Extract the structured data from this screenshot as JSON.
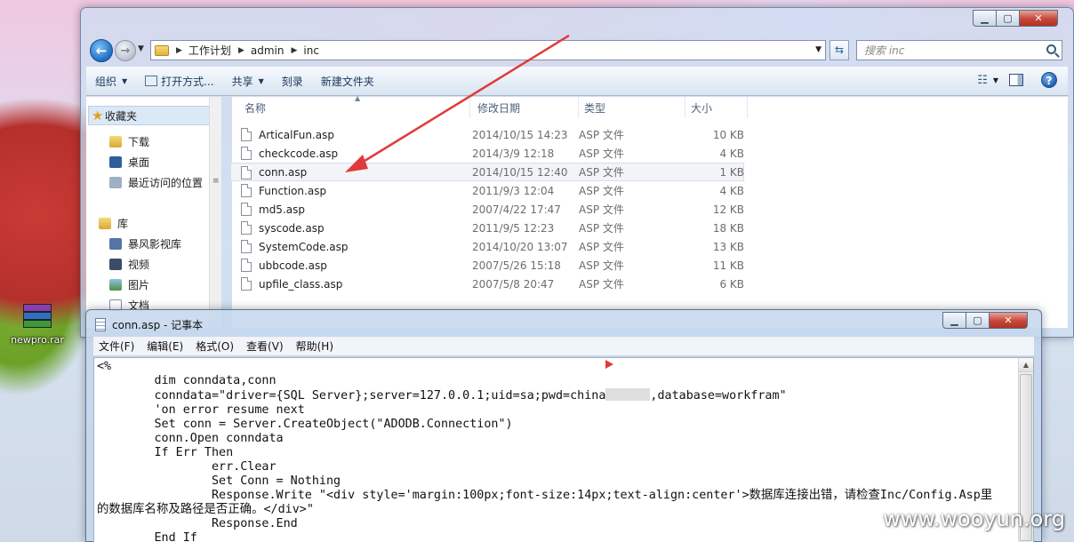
{
  "explorer": {
    "breadcrumb": [
      "工作计划",
      "admin",
      "inc"
    ],
    "search_placeholder": "搜索 inc",
    "toolbar": {
      "organize": "组织",
      "open_with": "打开方式...",
      "share": "共享",
      "burn": "刻录",
      "new_folder": "新建文件夹"
    },
    "nav": {
      "favorites": "收藏夹",
      "downloads": "下载",
      "desktop": "桌面",
      "recent": "最近访问的位置",
      "libraries": "库",
      "storm_video": "暴风影视库",
      "videos": "视频",
      "pictures": "图片",
      "documents": "文档"
    },
    "columns": {
      "name": "名称",
      "modified": "修改日期",
      "type": "类型",
      "size": "大小"
    },
    "files": [
      {
        "name": "ArticalFun.asp",
        "date": "2014/10/15 14:23",
        "type": "ASP 文件",
        "size": "10 KB"
      },
      {
        "name": "checkcode.asp",
        "date": "2014/3/9 12:18",
        "type": "ASP 文件",
        "size": "4 KB"
      },
      {
        "name": "conn.asp",
        "date": "2014/10/15 12:40",
        "type": "ASP 文件",
        "size": "1 KB"
      },
      {
        "name": "Function.asp",
        "date": "2011/9/3 12:04",
        "type": "ASP 文件",
        "size": "4 KB"
      },
      {
        "name": "md5.asp",
        "date": "2007/4/22 17:47",
        "type": "ASP 文件",
        "size": "12 KB"
      },
      {
        "name": "syscode.asp",
        "date": "2011/9/5 12:23",
        "type": "ASP 文件",
        "size": "18 KB"
      },
      {
        "name": "SystemCode.asp",
        "date": "2014/10/20 13:07",
        "type": "ASP 文件",
        "size": "13 KB"
      },
      {
        "name": "ubbcode.asp",
        "date": "2007/5/26 15:18",
        "type": "ASP 文件",
        "size": "11 KB"
      },
      {
        "name": "upfile_class.asp",
        "date": "2007/5/8 20:47",
        "type": "ASP 文件",
        "size": "6 KB"
      }
    ],
    "selected_file": "conn.asp"
  },
  "desktop": {
    "icon_label": "newpro.rar"
  },
  "notepad": {
    "title": "conn.asp - 记事本",
    "menus": [
      "文件(F)",
      "编辑(E)",
      "格式(O)",
      "查看(V)",
      "帮助(H)"
    ],
    "code": {
      "l1": "<%",
      "l2": "        dim conndata,conn",
      "l3a": "        conndata=\"driver={SQL Server};server=127.0.0.1;uid=sa;pwd=china",
      "l3b": ",database=workfram\"",
      "l4": "        'on error resume next",
      "l5": "        Set conn = Server.CreateObject(\"ADODB.Connection\")",
      "l6": "        conn.Open conndata",
      "l7": "        If Err Then",
      "l8": "                err.Clear",
      "l9": "                Set Conn = Nothing",
      "l10": "                Response.Write \"<div style='margin:100px;font-size:14px;text-align:center'>数据库连接出错，请检查Inc/Config.Asp里",
      "l11": "的数据库名称及路径是否正确。</div>\"",
      "l12": "                Response.End",
      "l13": "        End If"
    }
  },
  "watermark": "www.wooyun.org",
  "colors": {
    "annotation_arrow": "#e23a3a",
    "selection": "#f2f4f7"
  }
}
